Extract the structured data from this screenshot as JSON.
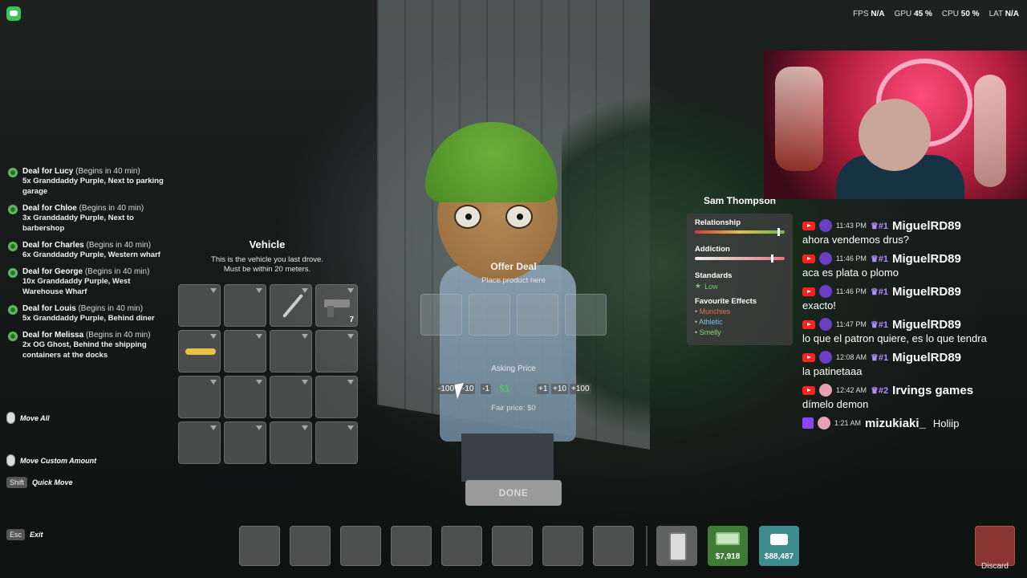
{
  "perf": {
    "fps_label": "FPS",
    "fps_value": "N/A",
    "gpu_label": "GPU",
    "gpu_value": "45 %",
    "cpu_label": "CPU",
    "cpu_value": "50 %",
    "lat_label": "LAT",
    "lat_value": "N/A"
  },
  "deals": [
    {
      "title": "Deal for Lucy",
      "timing": "(Begins in 40 min)",
      "desc": "5x Granddaddy Purple, Next to parking garage"
    },
    {
      "title": "Deal for Chloe",
      "timing": "(Begins in 40 min)",
      "desc": "3x Granddaddy Purple, Next to barbershop"
    },
    {
      "title": "Deal for Charles",
      "timing": "(Begins in 40 min)",
      "desc": "6x Granddaddy Purple, Western wharf"
    },
    {
      "title": "Deal for George",
      "timing": "(Begins in 40 min)",
      "desc": "10x Granddaddy Purple, West Warehouse Wharf"
    },
    {
      "title": "Deal for Louis",
      "timing": "(Begins in 40 min)",
      "desc": "5x Granddaddy Purple, Behind diner"
    },
    {
      "title": "Deal for Melissa",
      "timing": "(Begins in 40 min)",
      "desc": "2x OG Ghost, Behind the shipping containers at the docks"
    }
  ],
  "hints": {
    "move_all": "Move All",
    "move_custom": "Move Custom Amount",
    "shift_key": "Shift",
    "quick_move": "Quick Move",
    "esc_key": "Esc",
    "exit": "Exit"
  },
  "vehicle": {
    "title": "Vehicle",
    "desc_line1": "This is the vehicle you last drove.",
    "desc_line2": "Must be within 20 meters.",
    "gun_count": "7"
  },
  "offer": {
    "title": "Offer Deal",
    "subtitle": "Place product here",
    "asking_label": "Asking Price",
    "btn_minus100": "-100",
    "btn_minus10": "-10",
    "btn_minus1": "-1",
    "price": "$1",
    "btn_plus1": "+1",
    "btn_plus10": "+10",
    "btn_plus100": "+100",
    "fair_price": "Fair price: $0",
    "done": "DONE"
  },
  "npc": {
    "name": "Sam Thompson",
    "relationship_label": "Relationship",
    "relationship_level": 0.92,
    "addiction_label": "Addiction",
    "addiction_level": 0.85,
    "standards_label": "Standards",
    "standards_value": "Low",
    "effects_label": "Favourite Effects",
    "effects": [
      "Munchies",
      "Athletic",
      "Smelly"
    ],
    "effect_colors": [
      "#e0745a",
      "#7fc3e8",
      "#8fd36a"
    ]
  },
  "chat": [
    {
      "time": "11:43 PM",
      "badge": "#1",
      "user": "MiguelRD89",
      "text": "ahora vendemos drus?"
    },
    {
      "time": "11:46 PM",
      "badge": "#1",
      "user": "MiguelRD89",
      "text": "aca es plata o plomo"
    },
    {
      "time": "11:46 PM",
      "badge": "#1",
      "user": "MiguelRD89",
      "text": "exacto!"
    },
    {
      "time": "11:47 PM",
      "badge": "#1",
      "user": "MiguelRD89",
      "text": "lo que el patron quiere, es lo que tendra"
    },
    {
      "time": "12:08 AM",
      "badge": "#1",
      "user": "MiguelRD89",
      "text": "la patinetaaa"
    },
    {
      "time": "12:42 AM",
      "badge": "#2",
      "user": "Irvings games",
      "text": "dímelo demon"
    },
    {
      "time": "1:21 AM",
      "badge": "",
      "user": "mizukiaki_",
      "text": "Holiip"
    }
  ],
  "hotbar": {
    "cash": "$7,918",
    "bank": "$88,487",
    "discard": "Discard"
  }
}
